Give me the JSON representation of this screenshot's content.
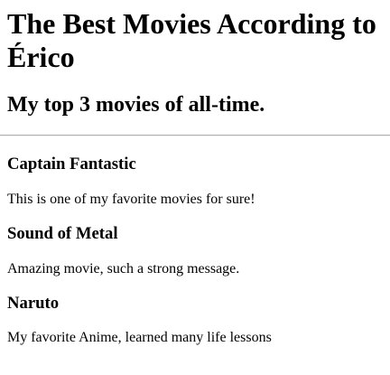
{
  "page": {
    "title": "The Best Movies According to Érico",
    "subtitle": "My top 3 movies of all-time."
  },
  "movies": [
    {
      "title": "Captain Fantastic",
      "description": "This is one of my favorite movies for sure!"
    },
    {
      "title": "Sound of Metal",
      "description": "Amazing movie, such a strong message."
    },
    {
      "title": "Naruto",
      "description": "My favorite Anime, learned many life lessons"
    }
  ]
}
